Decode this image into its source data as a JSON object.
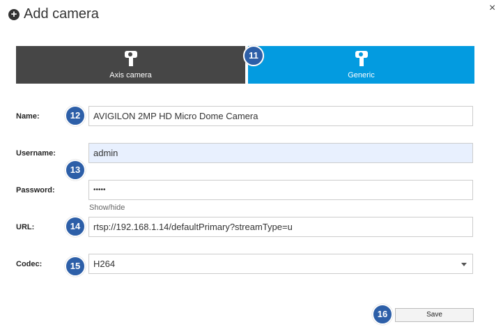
{
  "dialog": {
    "title": "Add camera",
    "close": "×"
  },
  "tabs": [
    {
      "label": "Axis camera",
      "active": false
    },
    {
      "label": "Generic",
      "active": true
    }
  ],
  "form": {
    "name": {
      "label": "Name:",
      "value": "AVIGILON 2MP HD Micro Dome Camera"
    },
    "username": {
      "label": "Username:",
      "value": "admin"
    },
    "password": {
      "label": "Password:",
      "value": "•••••",
      "toggle": "Show/hide"
    },
    "url": {
      "label": "URL:",
      "value": "rtsp://192.168.1.14/defaultPrimary?streamType=u"
    },
    "codec": {
      "label": "Codec:",
      "value": "H264"
    }
  },
  "save_label": "Save",
  "callouts": [
    "11",
    "12",
    "13",
    "14",
    "15",
    "16"
  ],
  "colors": {
    "tab_inactive": "#464646",
    "tab_active": "#039be0",
    "callout": "#2d5fa8",
    "autofill": "#e8f0fe"
  }
}
